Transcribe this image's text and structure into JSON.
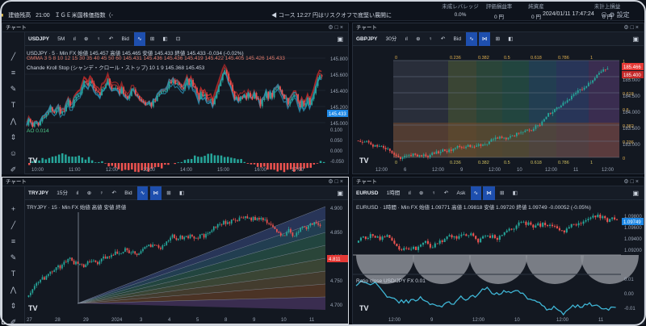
{
  "top_bar": {
    "ticker_label": "建値残高",
    "ticker_time": "21:00",
    "ticker_text": "ＩＧＥ米国株価指数（-",
    "news_text": "コース 12:27 円はリスクオフで底堅い展開に",
    "account_items": [
      {
        "label": "未成レバレッジ",
        "value": "0.0%"
      },
      {
        "label": "評価損益率",
        "value": "0 円"
      },
      {
        "label": "純資産",
        "value": "0 円"
      },
      {
        "label": "未計上損益",
        "value": "0 円"
      }
    ],
    "datetime": "2024/01/11 17:47:24",
    "settings_label": "設定"
  },
  "panels": [
    {
      "title": "チャート",
      "symbol": "USDJPY",
      "interval": "5分足",
      "toolbar": [
        "5M",
        "指標",
        "足",
        "比較",
        "Bid",
        "ライン",
        "表示",
        "設定"
      ],
      "legend": {
        "line1": "USDJPY · 5 · Min FX 始値 145.457 高値 145.465 安値 145.433 終値 145.433 -0.034 (-0.02%)",
        "line2": "GMMA 3 5 8 10 12 15 30 35 40 45 50 60  145.431 145.436 145.436 145.419 145.422 145.405 145.426 145.433",
        "line3": "Chande Kroll Stop (シャンデ・クロール・ストップ) 10 1 9  145.368 145.453",
        "sub": "AO  0.014"
      },
      "price_axis": [
        "145.800",
        "145.600",
        "145.400",
        "145.200",
        "145.000",
        "0.100",
        "0.050",
        "0.000",
        "-0.050"
      ],
      "last_price": "145.433",
      "time_axis": [
        "10:00",
        "11:00",
        "12:00",
        "13:00",
        "14:00",
        "15:00",
        "16:00",
        "17:00"
      ]
    },
    {
      "title": "チャート",
      "symbol": "GBPJPY",
      "interval": "30分足",
      "toolbar": [
        "30分",
        "指標",
        "足",
        "比較",
        "Bid",
        "ライン",
        "表示",
        "設定"
      ],
      "fib_levels": [
        "0",
        "0.236",
        "0.382",
        "0.5",
        "0.618",
        "0.786",
        "1"
      ],
      "fib_bottom": [
        "0",
        "0.236",
        "0.382",
        "0.5",
        "0.618",
        "0.786",
        "1"
      ],
      "fib_right": [
        "1",
        "0.786",
        "0.618",
        "0.5",
        "0.382",
        "0.236",
        "0"
      ],
      "price_axis": [
        "185.000",
        "184.500",
        "184.000",
        "183.500",
        "183.000"
      ],
      "last_price": "185.466",
      "last_price2": "185.400",
      "time_axis": [
        "12:00",
        "6",
        "12:00",
        "9",
        "12:00",
        "10",
        "12:00",
        "11",
        "12:00"
      ]
    },
    {
      "title": "チャート",
      "symbol": "TRYJPY",
      "interval": "15分足",
      "toolbar": [
        "15分",
        "指標",
        "足",
        "比較",
        "Bid",
        "ライン",
        "表示",
        "設定"
      ],
      "legend": "TRYJPY · 15 · Min FX 始値 高値 安値 終値",
      "price_axis": [
        "4.900",
        "4.850",
        "4.800",
        "4.750",
        "4.700"
      ],
      "last_price": "4.811",
      "time_axis": [
        "27",
        "28",
        "29",
        "2024",
        "3",
        "4",
        "5",
        "8",
        "9",
        "10",
        "11"
      ]
    },
    {
      "title": "チャート",
      "symbol": "EURUSD",
      "interval": "1時間足",
      "toolbar": [
        "1時間",
        "指標",
        "足",
        "比較",
        "Ask",
        "ライン",
        "表示",
        "設定"
      ],
      "legend": "EURUSD · 1時間 · Min FX 始値 1.09771 高値 1.09818 安値 1.09720 終値 1.09749 -0.00052 (-0.05%)",
      "sub_legend": "Ratio close USD/JPY FX  0.01",
      "price_axis": [
        "1.09800",
        "1.09600",
        "1.09400",
        "1.09200",
        "0.01",
        "0.00",
        "-0.01"
      ],
      "last_price": "1.09749",
      "time_axis": [
        "12:00",
        "9",
        "12:00",
        "10",
        "12:00",
        "11"
      ]
    }
  ],
  "drawing_tools": [
    "crosshair-icon",
    "trendline-icon",
    "fib-icon",
    "brush-icon",
    "text-icon",
    "pattern-icon",
    "measure-icon",
    "zoom-icon",
    "magnet-icon",
    "lock-icon",
    "eye-icon",
    "trash-icon"
  ],
  "colors": {
    "up": "#26a69a",
    "down": "#ef5350",
    "accent": "#1e4fae",
    "background": "#131821"
  }
}
